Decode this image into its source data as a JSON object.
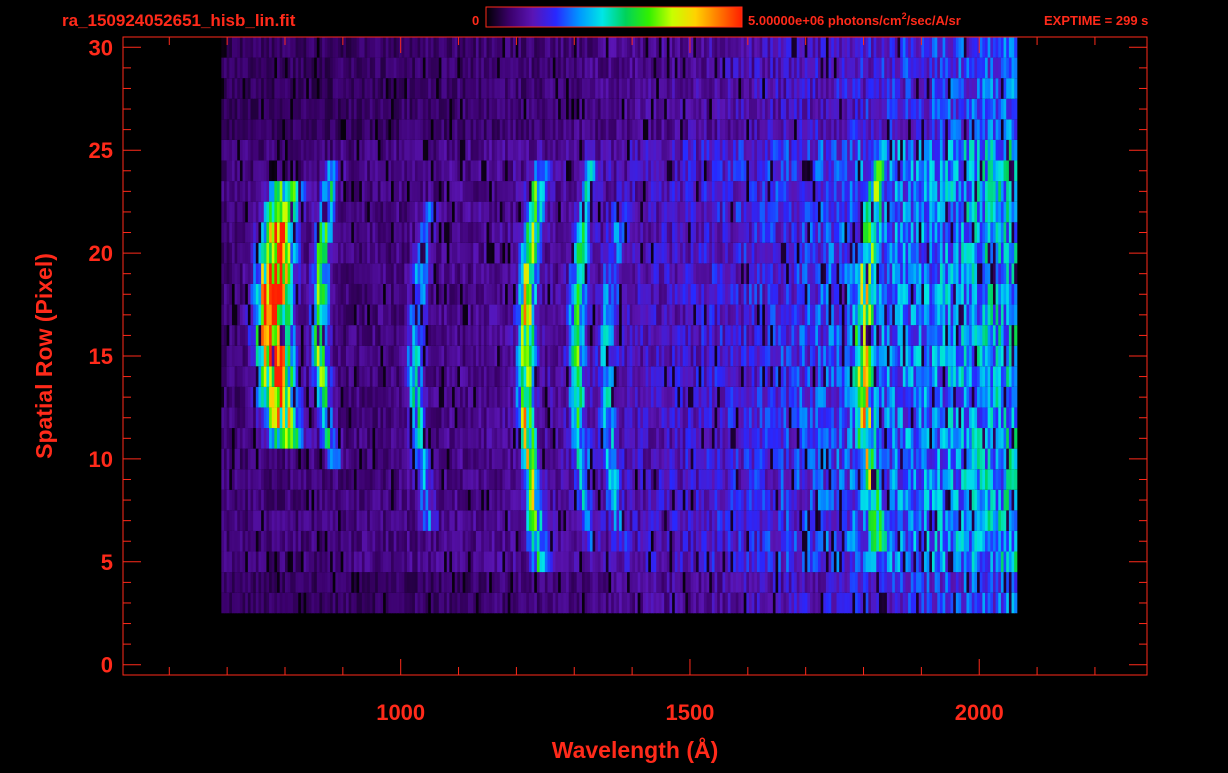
{
  "header": {
    "filename": "ra_150924052651_hisb_lin.fit",
    "cbar_min": "0",
    "cbar_max_prefix": "5.00000e+06 photons/cm",
    "cbar_max_sup": "2",
    "cbar_max_suffix": "/sec/A/sr",
    "exptime": "EXPTIME = 299 s"
  },
  "colors": {
    "axis": "#ff2a1a",
    "background": "#000000",
    "colormap": [
      "#000000",
      "#3a006a",
      "#5a14b4",
      "#2828ff",
      "#0096ff",
      "#00e6e6",
      "#00d25a",
      "#32f000",
      "#c8ff00",
      "#ffd200",
      "#ff7800",
      "#ff1e00"
    ]
  },
  "chart_data": {
    "type": "heatmap",
    "title": "ra_150924052651_hisb_lin.fit",
    "xlabel": "Wavelength (Å)",
    "ylabel": "Spatial Row (Pixel)",
    "xlim": [
      520,
      2290
    ],
    "ylim": [
      -0.5,
      30.5
    ],
    "xticks": [
      1000,
      1500,
      2000
    ],
    "yticks": [
      0,
      5,
      10,
      15,
      20,
      25,
      30
    ],
    "color_range": [
      0,
      5000000
    ],
    "color_unit": "photons/cm2/sec/A/sr",
    "exptime_s": 299,
    "rows_covered": [
      3,
      30
    ],
    "wavelength_coverage": [
      690,
      2065
    ],
    "emission_features": [
      {
        "wavelength": 780,
        "rows": [
          11,
          23
        ],
        "peak": 1.0
      },
      {
        "wavelength": 860,
        "rows": [
          10,
          24
        ],
        "peak": 0.55
      },
      {
        "wavelength": 1025,
        "rows": [
          7,
          22
        ],
        "peak": 0.35
      },
      {
        "wavelength": 1216,
        "rows": [
          5,
          24
        ],
        "peak": 0.65
      },
      {
        "wavelength": 1304,
        "rows": [
          6,
          24
        ],
        "peak": 0.38
      },
      {
        "wavelength": 1356,
        "rows": [
          6,
          22
        ],
        "peak": 0.25
      },
      {
        "wavelength": 1800,
        "rows": [
          6,
          24
        ],
        "peak": 0.45
      }
    ]
  }
}
